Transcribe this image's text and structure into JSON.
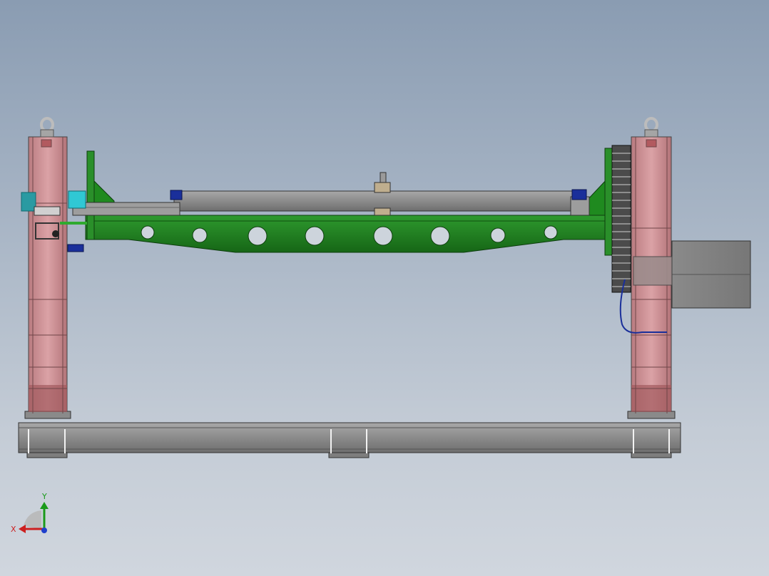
{
  "triad": {
    "x_label": "X",
    "y_label": "Y",
    "colors": {
      "x": "#cc1f1f",
      "y": "#1a9a1a",
      "z": "#1f3fcc"
    }
  },
  "palette": {
    "background_top": "#8a9cb2",
    "background_bottom": "#d0d6de",
    "column": "#d4959a",
    "beam_gray": "#8e8e8e",
    "frame_green": "#1c7a1c",
    "bracket_blue": "#1a2f9a",
    "cyan_shaft": "#30c8d4",
    "hook_silver": "#c8c8c8"
  },
  "model": {
    "name": "",
    "lightening_holes": 8
  }
}
